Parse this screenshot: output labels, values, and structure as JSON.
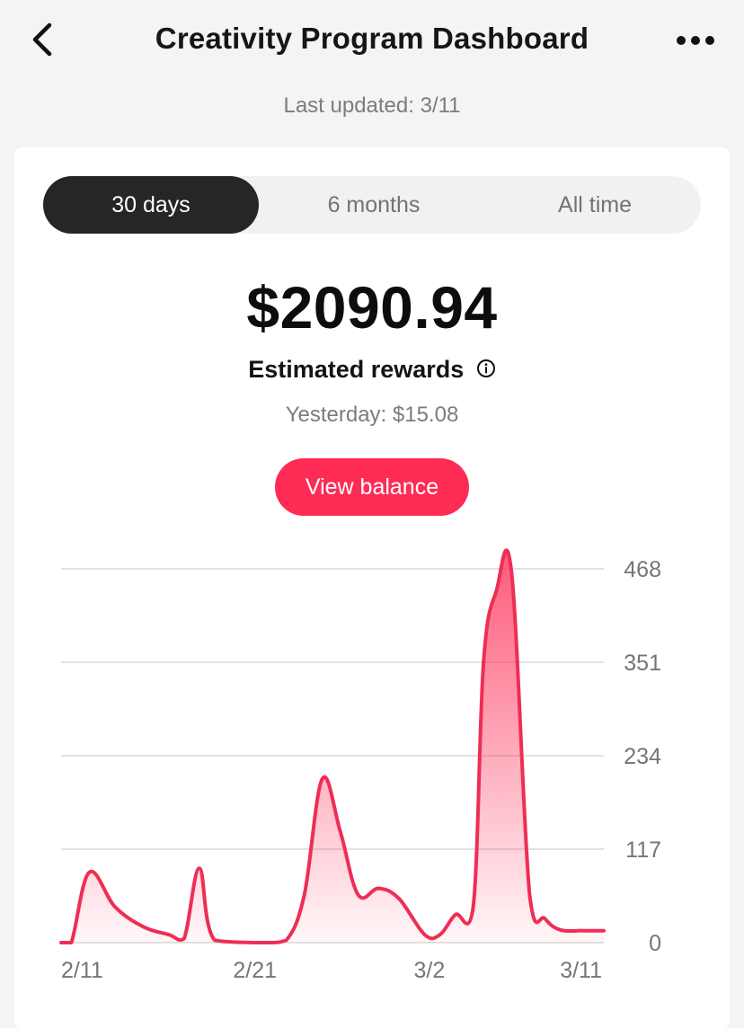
{
  "header": {
    "title": "Creativity Program Dashboard",
    "back_icon": "chevron-left-icon",
    "more_icon": "more-horizontal-icon"
  },
  "last_updated": "Last updated: 3/11",
  "tabs": [
    {
      "label": "30 days",
      "active": true
    },
    {
      "label": "6 months",
      "active": false
    },
    {
      "label": "All time",
      "active": false
    }
  ],
  "summary": {
    "amount": "$2090.94",
    "label": "Estimated rewards",
    "info_icon": "info-circle-icon",
    "yesterday": "Yesterday: $15.08"
  },
  "actions": {
    "view_balance": "View balance"
  },
  "colors": {
    "accent": "#fe2c55",
    "line": "#ee2e55",
    "active_tab": "#262626"
  },
  "chart_data": {
    "type": "area",
    "x_ticks": [
      "2/11",
      "2/21",
      "3/2",
      "3/11"
    ],
    "y_ticks": [
      "468",
      "351",
      "234",
      "117",
      "0"
    ],
    "ylim": [
      0,
      468
    ],
    "grid": true,
    "series": [
      {
        "values": [
          [
            0,
            0
          ],
          [
            0.4,
            0
          ],
          [
            1.1,
            88
          ],
          [
            2.1,
            45
          ],
          [
            3.2,
            20
          ],
          [
            4.2,
            10
          ],
          [
            4.8,
            5
          ],
          [
            5.4,
            93
          ],
          [
            6,
            3
          ],
          [
            8,
            0
          ],
          [
            8.8,
            3
          ],
          [
            9.5,
            60
          ],
          [
            10.2,
            205
          ],
          [
            10.9,
            140
          ],
          [
            11.6,
            60
          ],
          [
            12.4,
            68
          ],
          [
            13.2,
            55
          ],
          [
            14.2,
            10
          ],
          [
            14.8,
            10
          ],
          [
            15.4,
            35
          ],
          [
            16.1,
            45
          ],
          [
            16.5,
            350
          ],
          [
            17,
            440
          ],
          [
            17.6,
            462
          ],
          [
            18.3,
            60
          ],
          [
            18.9,
            30
          ],
          [
            19.5,
            16
          ],
          [
            20.4,
            15
          ],
          [
            21.2,
            15
          ]
        ]
      }
    ]
  }
}
